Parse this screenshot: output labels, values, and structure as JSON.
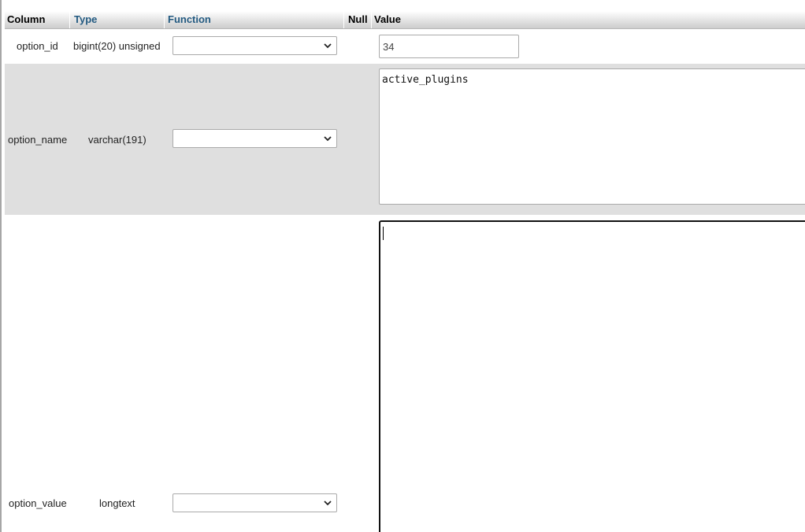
{
  "headers": {
    "column": "Column",
    "type": "Type",
    "function": "Function",
    "null": "Null",
    "value": "Value"
  },
  "rows": [
    {
      "column": "option_id",
      "type": "bigint(20) unsigned",
      "function": "",
      "value": "34"
    },
    {
      "column": "option_name",
      "type": "varchar(191)",
      "function": "",
      "value": "active_plugins"
    },
    {
      "column": "option_value",
      "type": "longtext",
      "function": "",
      "value": ""
    }
  ],
  "icons": {
    "select_arrow": "chevron-down-icon"
  },
  "colors": {
    "link": "#235a81",
    "row_alt": "#dfdfdf",
    "border": "#aaaaaa",
    "focus_border": "#111111"
  }
}
